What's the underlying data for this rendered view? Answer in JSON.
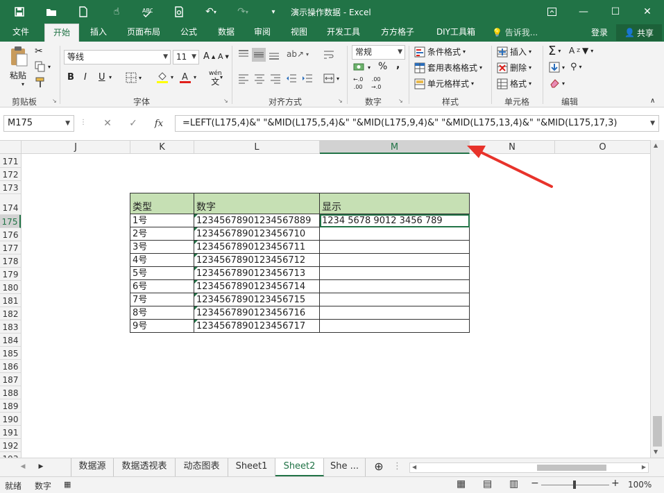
{
  "window": {
    "title": "演示操作数据 - Excel"
  },
  "tabs": [
    "文件",
    "开始",
    "插入",
    "页面布局",
    "公式",
    "数据",
    "审阅",
    "视图",
    "开发工具",
    "方方格子",
    "DIY工具箱"
  ],
  "tell_me": "告诉我...",
  "login": "登录",
  "share": "共享",
  "ribbon": {
    "clipboard": {
      "paste": "粘贴",
      "label": "剪贴板"
    },
    "font": {
      "name": "等线",
      "size": "11",
      "bold": "B",
      "italic": "I",
      "underline": "U",
      "phonetic": "wén",
      "label": "字体"
    },
    "align": {
      "label": "对齐方式"
    },
    "number": {
      "format": "常规",
      "percent": "%",
      "comma": ",",
      "label": "数字"
    },
    "styles": {
      "cond": "条件格式",
      "table": "套用表格格式",
      "cell": "单元格样式",
      "label": "样式"
    },
    "cells": {
      "insert": "插入",
      "delete": "删除",
      "format": "格式",
      "label": "单元格"
    },
    "edit": {
      "label": "编辑"
    }
  },
  "namebox": "M175",
  "formula": "=LEFT(L175,4)&\" \"&MID(L175,5,4)&\" \"&MID(L175,9,4)&\" \"&MID(L175,13,4)&\" \"&MID(L175,17,3)",
  "columns": [
    "J",
    "K",
    "L",
    "M",
    "N",
    "O"
  ],
  "rows": [
    "171",
    "172",
    "173",
    "174",
    "175",
    "176",
    "177",
    "178",
    "179",
    "180",
    "181",
    "182",
    "183",
    "184",
    "185",
    "186",
    "187",
    "188",
    "189",
    "190",
    "191",
    "192",
    "193"
  ],
  "table": {
    "headers": [
      "类型",
      "数字",
      "显示"
    ],
    "rows": [
      [
        "1号",
        "12345678901234567889",
        "1234 5678 9012 3456 789"
      ],
      [
        "2号",
        "123456789012345671​0",
        ""
      ],
      [
        "3号",
        "1234567890123456711",
        ""
      ],
      [
        "4号",
        "1234567890123456712",
        ""
      ],
      [
        "5号",
        "1234567890123456713",
        ""
      ],
      [
        "6号",
        "1234567890123456714",
        ""
      ],
      [
        "7号",
        "1234567890123456715",
        ""
      ],
      [
        "8号",
        "1234567890123456716",
        ""
      ],
      [
        "9号",
        "1234567890123456717",
        ""
      ]
    ]
  },
  "sheets": [
    "数据源",
    "数据透视表",
    "动态图表",
    "Sheet1",
    "Sheet2",
    "She ..."
  ],
  "status": {
    "ready": "就绪",
    "num": "数字",
    "zoom": "100%"
  },
  "colors": {
    "brand": "#217346",
    "header_fill": "#c6e0b4",
    "arrow": "#e8332b"
  }
}
